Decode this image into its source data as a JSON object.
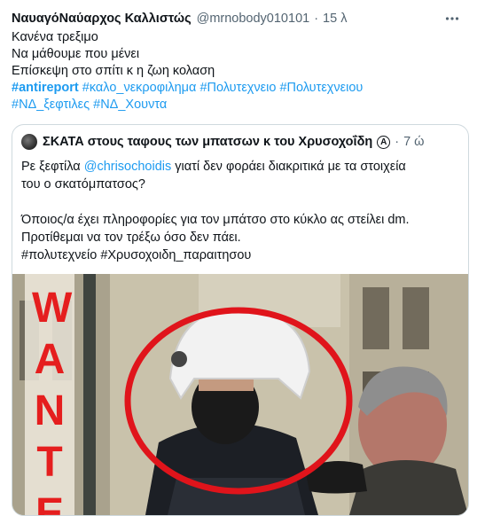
{
  "tweet": {
    "author_name": "ΝαυαγόΝαύαρχος Καλλιστώς",
    "author_handle": "@mrnobody010101",
    "separator": "·",
    "time": "15 λ",
    "lines": [
      "Κανένα τρεξιμο",
      "Να μάθουμε που μένει",
      "Επίσκεψη στο σπίτι κ η ζωη κολαση"
    ],
    "hashtags_line1": [
      "#antireport",
      "#καλο_νεκροφιλημα",
      "#Πολυτεχνειο",
      "#Πολυτεχνειου"
    ],
    "hashtags_line2": [
      "#ΝΔ_ξεφτιλες",
      "#ΝΔ_Χουντα"
    ]
  },
  "quote": {
    "author_name": "ΣΚΑΤΑ στους ταφους των μπατσων κ του Χρυσοχοΐδη",
    "badge": "A",
    "separator": "·",
    "time": "7 ώ",
    "lines": [
      "Ρε ξεφτίλα @chrisochoidis γιατί δεν φοράει διακριτικά με τα στοιχεία",
      "του ο σκατόμπατσος?",
      "",
      "Όποιος/α έχει πληροφορίες για τον μπάτσο στο κύκλο ας στείλει dm.",
      "Προτίθεμαι να τον τρέξω όσο δεν πάει.",
      "#πολυτεχνείο #Χρυσοχοιδη_παραιτησου"
    ],
    "photo_banner": [
      "W",
      "A",
      "N",
      "T",
      "E"
    ]
  },
  "colors": {
    "text": "#0f1419",
    "secondary": "#536471",
    "link": "#1d9bf0",
    "border": "#cfd9de",
    "circle": "#e0141b",
    "banner": "#e51e1e"
  },
  "icons": {
    "more": "more-horizontal-icon"
  }
}
